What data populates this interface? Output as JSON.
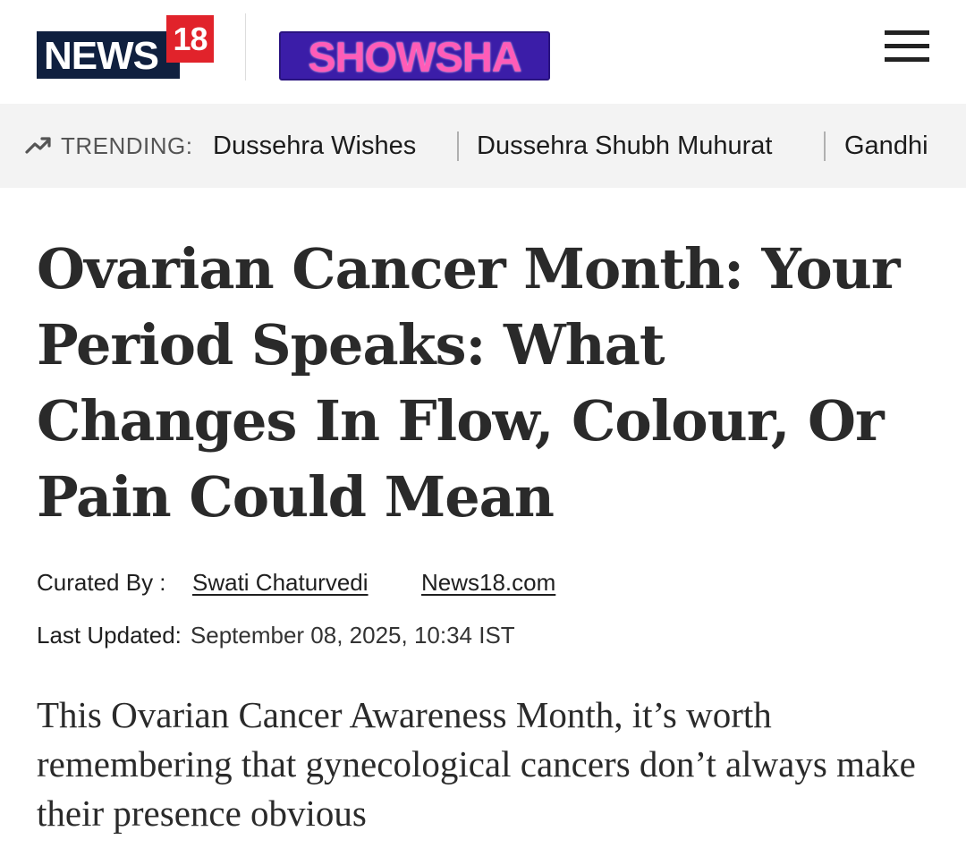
{
  "header": {
    "logo_main": "NEWS",
    "logo_badge": "18",
    "logo_section": "SHOWSHA",
    "menu_icon": "hamburger-menu-icon"
  },
  "trending": {
    "icon": "trending-up-icon",
    "label": "TRENDING:",
    "items": [
      "Dussehra Wishes",
      "Dussehra Shubh Muhurat",
      "Gandhi"
    ]
  },
  "article": {
    "headline": "Ovarian Cancer Month: Your Period Speaks: What Changes In Flow, Colour, Or Pain Could Mean",
    "curated_label": "Curated By :",
    "author": "Swati Chaturvedi",
    "source": "News18.com",
    "updated_label": "Last Updated:",
    "updated_value": "September 08, 2025, 10:34 IST",
    "summary": "This Ovarian Cancer Awareness Month, it’s worth remembering that gynecological cancers don’t always make their presence obvious"
  },
  "colors": {
    "brand_navy": "#10203f",
    "brand_red": "#e1232b",
    "showsha_bg": "#3b1da8",
    "showsha_text": "#ff5cb8",
    "trending_bg": "#f3f3f3"
  }
}
